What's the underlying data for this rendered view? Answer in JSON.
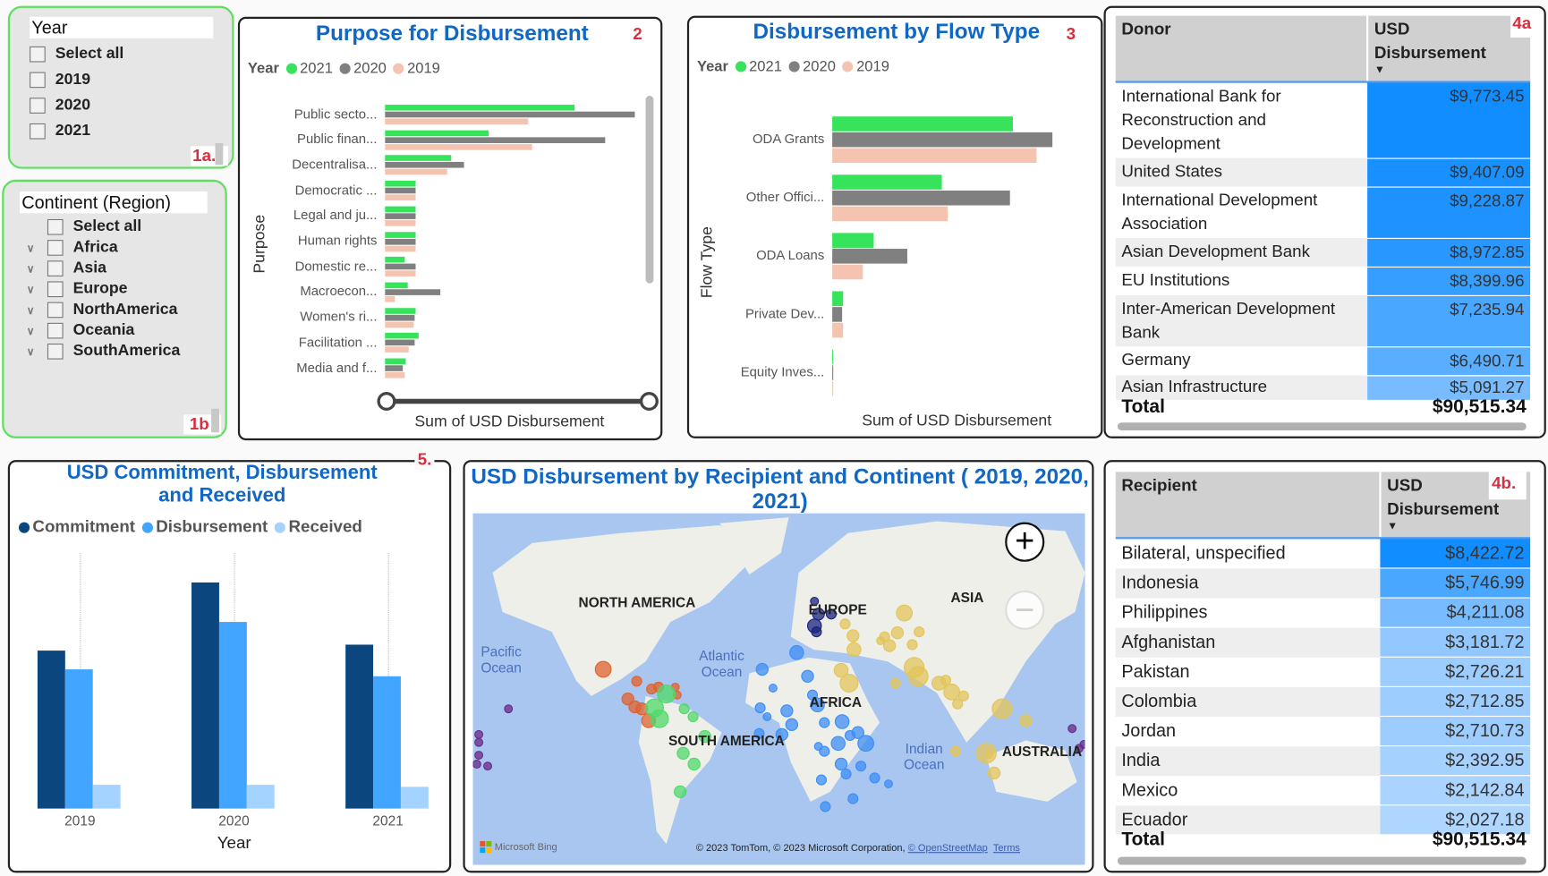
{
  "year_slicer": {
    "title": "Year",
    "tag": "1a.",
    "items": [
      "Select all",
      "2019",
      "2020",
      "2021"
    ]
  },
  "continent_slicer": {
    "title": "Continent (Region)",
    "tag": "1b",
    "items": [
      "Select all",
      "Africa",
      "Asia",
      "Europe",
      "NorthAmerica",
      "Oceania",
      "SouthAmerica"
    ]
  },
  "colors": {
    "y2021": "#36e35a",
    "y2020": "#808080",
    "y2019": "#f5c4b0",
    "commitment": "#0b467e",
    "disbursement": "#42a5ff",
    "received": "#a5d3ff",
    "title": "#1067c4",
    "tag": "#d63040"
  },
  "chart_data": [
    {
      "type": "bar",
      "orientation": "horizontal",
      "title": "Purpose for Disbursement",
      "tag": "2",
      "legend_title": "Year",
      "xlabel": "Sum of USD Disbursement",
      "ylabel": "Purpose",
      "legend_placement": "top-left",
      "categories": [
        "Public secto...",
        "Public finan...",
        "Decentralisa...",
        "Democratic ...",
        "Legal and ju...",
        "Human rights",
        "Domestic re...",
        "Macroecon...",
        "Women's ri...",
        "Facilitation ...",
        "Media and f..."
      ],
      "series": [
        {
          "name": "2021",
          "values": [
            192,
            105,
            67,
            31,
            31,
            31,
            20,
            23,
            31,
            34,
            21
          ]
        },
        {
          "name": "2020",
          "values": [
            253,
            223,
            80,
            31,
            31,
            31,
            31,
            56,
            30,
            30,
            18
          ]
        },
        {
          "name": "2019",
          "values": [
            145,
            149,
            63,
            31,
            31,
            31,
            31,
            10,
            29,
            24,
            20
          ]
        }
      ]
    },
    {
      "type": "bar",
      "orientation": "horizontal",
      "title": "Disbursement by Flow Type",
      "tag": "3",
      "legend_title": "Year",
      "xlabel": "Sum of USD Disbursement",
      "ylabel": "Flow Type",
      "legend_placement": "top-left",
      "categories": [
        "ODA Grants",
        "Other Offici...",
        "ODA Loans",
        "Private Dev...",
        "Equity Inves..."
      ],
      "series": [
        {
          "name": "2021",
          "values": [
            183,
            111,
            42,
            11,
            1
          ]
        },
        {
          "name": "2020",
          "values": [
            223,
            180,
            76,
            10,
            1
          ]
        },
        {
          "name": "2019",
          "values": [
            207,
            117,
            31,
            11,
            1
          ]
        }
      ]
    },
    {
      "type": "bar",
      "title": "USD Commitment, Disbursement and Received",
      "tag": "5.",
      "xlabel": "Year",
      "legend_placement": "top-left",
      "categories": [
        "2019",
        "2020",
        "2021"
      ],
      "series": [
        {
          "name": "Commitment",
          "values": [
            160,
            229,
            166
          ]
        },
        {
          "name": "Disbursement",
          "values": [
            141,
            189,
            134
          ]
        },
        {
          "name": "Received",
          "values": [
            24,
            24,
            22
          ]
        }
      ]
    }
  ],
  "donor_table": {
    "tag": "4a",
    "headers": [
      "Donor",
      "USD Disbursement"
    ],
    "rows": [
      {
        "name": "International Bank for Reconstruction and Development",
        "value": "$9,773.45",
        "color": "#118dff"
      },
      {
        "name": "United States",
        "value": "$9,407.09",
        "color": "#1890ff"
      },
      {
        "name": "International Development Association",
        "value": "$9,228.87",
        "color": "#1e92ff"
      },
      {
        "name": "Asian Development Bank",
        "value": "$8,972.85",
        "color": "#2897ff"
      },
      {
        "name": "EU Institutions",
        "value": "$8,399.96",
        "color": "#369eff"
      },
      {
        "name": "Inter-American Development Bank",
        "value": "$7,235.94",
        "color": "#4aa7ff"
      },
      {
        "name": "Germany",
        "value": "$6,490.71",
        "color": "#5aaeff"
      },
      {
        "name": "Asian Infrastructure",
        "value": "$5,091.27",
        "color": "#78bcff"
      }
    ],
    "total_label": "Total",
    "total": "$90,515.34"
  },
  "recipient_table": {
    "tag": "4b.",
    "headers": [
      "Recipient",
      "USD Disbursement"
    ],
    "rows": [
      {
        "name": "Bilateral, unspecified",
        "value": "$8,422.72",
        "color": "#118dff"
      },
      {
        "name": "Indonesia",
        "value": "$5,746.99",
        "color": "#4aa7ff"
      },
      {
        "name": "Philippines",
        "value": "$4,211.08",
        "color": "#78bcff"
      },
      {
        "name": "Afghanistan",
        "value": "$3,181.72",
        "color": "#92c8ff"
      },
      {
        "name": "Pakistan",
        "value": "$2,726.21",
        "color": "#9dcdff"
      },
      {
        "name": "Colombia",
        "value": "$2,712.85",
        "color": "#9dcdff"
      },
      {
        "name": "Jordan",
        "value": "$2,710.73",
        "color": "#9dcdff"
      },
      {
        "name": "India",
        "value": "$2,392.95",
        "color": "#a5d1ff"
      },
      {
        "name": "Mexico",
        "value": "$2,142.84",
        "color": "#aad4ff"
      },
      {
        "name": "Ecuador",
        "value": "$2,027.18",
        "color": "#aed6ff"
      }
    ],
    "total_label": "Total",
    "total": "$90,515.34"
  },
  "map": {
    "title": "USD Disbursement by Recipient and Continent ( 2019, 2020, 2021)",
    "continent_labels": [
      "NORTH AMERICA",
      "EUROPE",
      "ASIA",
      "AFRICA",
      "SOUTH AMERICA",
      "AUSTRALIA"
    ],
    "ocean_labels": [
      "Pacific Ocean",
      "Atlantic Ocean",
      "Indian Ocean"
    ],
    "bubble_colors": {
      "NorthAmerica": "#e0622e",
      "SouthAmerica": "#4fd96a",
      "Europe": "#1a237e",
      "Africa": "#3d8ef5",
      "Asia": "#e3c45a",
      "Oceania": "#6a2a8a"
    },
    "logo": "Microsoft Bing",
    "attribution": "© 2023 TomTom, © 2023 Microsoft Corporation,",
    "osm": "© OpenStreetMap",
    "terms": "Terms",
    "zoom_in": "+",
    "zoom_out": "−"
  }
}
